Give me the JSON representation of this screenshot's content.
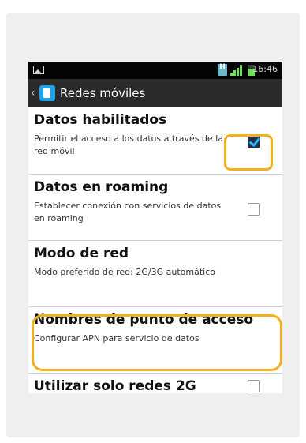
{
  "status_bar": {
    "time": "16:46",
    "network_badge": "H"
  },
  "action_bar": {
    "back_icon": "back-chevron",
    "app_icon": "sim-card-icon",
    "title": "Redes móviles"
  },
  "settings": [
    {
      "title": "Datos habilitados",
      "subtitle": "Permitir el acceso a los datos a través de la red móvil",
      "checkbox": true,
      "checked": true
    },
    {
      "title": "Datos en roaming",
      "subtitle": "Establecer conexión con servicios de datos en roaming",
      "checkbox": true,
      "checked": false
    },
    {
      "title": "Modo de red",
      "subtitle": "Modo preferido de red: 2G/3G automático",
      "checkbox": false
    },
    {
      "title": "Nombres de punto de acceso",
      "subtitle": "Configurar APN para servicio de datos",
      "checkbox": false
    },
    {
      "title": "Utilizar solo redes 2G",
      "subtitle": "",
      "checkbox": true,
      "checked": false
    }
  ],
  "highlight_color": "#f2b01f"
}
